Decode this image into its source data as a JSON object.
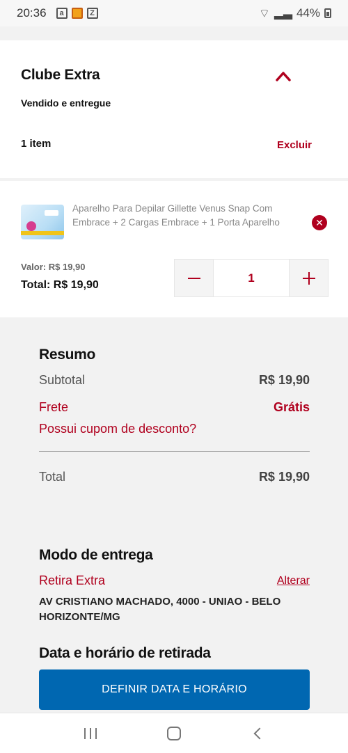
{
  "status_bar": {
    "time": "20:36",
    "battery": "44%"
  },
  "store": {
    "title": "Clube Extra",
    "subtitle": "Vendido e entregue",
    "item_count": "1 item",
    "delete_label": "Excluir"
  },
  "product": {
    "name": "Aparelho Para Depilar Gillette Venus Snap Com Embrace + 2 Cargas Embrace + 1 Porta Aparelho",
    "unit_value": "Valor: R$ 19,90",
    "total_value": "Total: R$ 19,90",
    "quantity": "1"
  },
  "summary": {
    "title": "Resumo",
    "subtotal_label": "Subtotal",
    "subtotal_value": "R$ 19,90",
    "shipping_label": "Frete",
    "shipping_value": "Grátis",
    "coupon_label": "Possui cupom de desconto?",
    "total_label": "Total",
    "total_value": "R$ 19,90"
  },
  "delivery": {
    "title": "Modo de entrega",
    "mode": "Retira Extra",
    "change_label": "Alterar",
    "address": "AV CRISTIANO MACHADO, 4000 - UNIAO - BELO HORIZONTE/MG"
  },
  "pickup": {
    "title": "Data e horário de retirada",
    "button_label": "DEFINIR DATA E HORÁRIO"
  },
  "colors": {
    "accent": "#b0001e",
    "button": "#0067b1"
  }
}
